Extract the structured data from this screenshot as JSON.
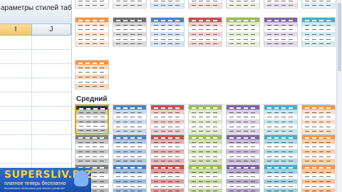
{
  "spreadsheet": {
    "command_label": "араметры стилей таблиц",
    "columns": [
      "I",
      "J"
    ],
    "selected_column": "I"
  },
  "gallery": {
    "section_medium": "Средний"
  },
  "watermark": {
    "title": "SUPERSLIV.BIZ",
    "subtitle": "платное теперь бесплатно",
    "subtitle2": "бесплатные материалы для вашего развития"
  },
  "styles": {
    "light_top": [
      [
        "#e6e6e6",
        "#f2f2f2"
      ],
      [
        "#1f1f1f",
        "#e9e9e9"
      ],
      [
        "#4f81bd",
        "#dbe5f1"
      ],
      [
        "#c0504d",
        "#f2dcdb"
      ],
      [
        "#9bbb59",
        "#ebf1de"
      ],
      [
        "#8064a2",
        "#e5e0ec"
      ],
      [
        "#4bacc6",
        "#dbeef3"
      ]
    ],
    "light_row2": [
      "#f79646",
      "#6a6a6a",
      "#4f81bd",
      "#c0504d",
      "#9bbb59",
      "#8064a2",
      "#4bacc6"
    ],
    "light_row3": [
      "#f79646"
    ],
    "medium": [
      "#333333",
      "#4f81bd",
      "#c0504d",
      "#9bbb59",
      "#8064a2",
      "#4bacc6",
      "#f79646"
    ],
    "medium_alt": [
      "#7f7f7f",
      "#4f81bd",
      "#c0504d",
      "#9bbb59",
      "#8064a2",
      "#4bacc6",
      "#f79646"
    ],
    "selected_index": 0
  }
}
